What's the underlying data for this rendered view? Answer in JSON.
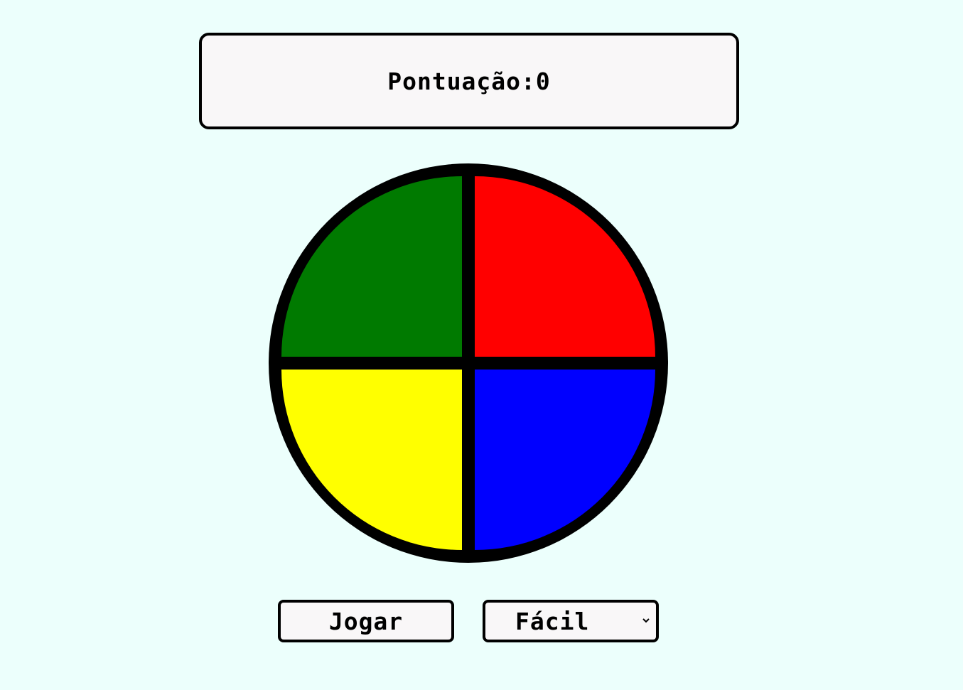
{
  "score": {
    "label": "Pontuação:0"
  },
  "board": {
    "quadrants": [
      {
        "name": "green",
        "color": "#007a00"
      },
      {
        "name": "red",
        "color": "#ff0000"
      },
      {
        "name": "yellow",
        "color": "#ffff00"
      },
      {
        "name": "blue",
        "color": "#0000ff"
      }
    ]
  },
  "controls": {
    "play_label": "Jogar",
    "difficulty_selected": "Fácil",
    "chevron_icon": "chevron-down-icon"
  },
  "colors": {
    "background": "#ecfffc",
    "panel": "#f9f7f8",
    "border": "#000000"
  }
}
